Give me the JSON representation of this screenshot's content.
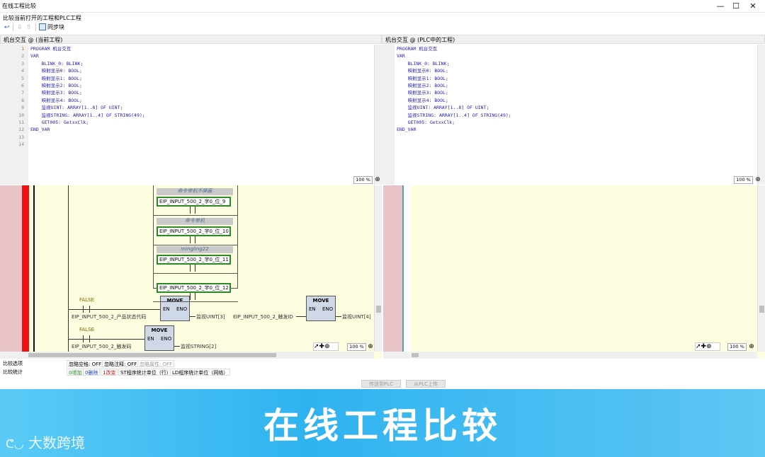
{
  "window": {
    "title": "在线工程比较",
    "min_glyph": "—",
    "max_glyph": "☐",
    "close_glyph": "✕"
  },
  "subtitle": "比较当前打开的工程和PLC工程",
  "toolbar": {
    "sync_label": "同步块"
  },
  "left_pane": {
    "header": "机台交互 @ (当前工程)",
    "zoom": "100 %"
  },
  "right_pane": {
    "header": "机台交互 @ (PLC中的工程)",
    "zoom": "100 %"
  },
  "line_numbers": [
    "1",
    "2",
    "3",
    "4",
    "5",
    "6",
    "7",
    "8",
    "9",
    "10",
    "11",
    "12",
    "13",
    "14"
  ],
  "code_lines": [
    "PROGRAM 机台交互",
    "VAR",
    "    BLINK_0: BLINK;",
    "    映射显示0: BOOL;",
    "    映射显示1: BOOL;",
    "    映射显示2: BOOL;",
    "    映射显示3: BOOL;",
    "    映射显示4: BOOL;",
    "    监视UINT: ARRAY[1..8] OF UINT;",
    "    监视STRING: ARRAY[1..4] OF STRING(49);",
    "    GET005: GetxxClk;",
    "END_VAR",
    "",
    ""
  ],
  "ladder": {
    "rungs": [
      {
        "comment": "命令单机不屏蔽",
        "var": "EIP_INPUT_500_2_字0_位_9"
      },
      {
        "comment": "命令单机",
        "var": "EIP_INPUT_500_2_字0_位_10"
      },
      {
        "comment": "mingling22",
        "var": "EIP_INPUT_500_2_字0_位_11"
      },
      {
        "comment": "",
        "var": "EIP_INPUT_500_2_字0_位_12"
      }
    ],
    "false1": "FALSE",
    "false2": "FALSE",
    "in1": "EIP_INPUT_500_2_产品状态代码",
    "in2": "EIP_INPUT_500_2_触发ID",
    "in3": "EIP_INPUT_500_2_触发码",
    "move_label": "MOVE",
    "en": "EN",
    "eno": "ENO",
    "out1": "监视UINT[3]",
    "out2": "监视UINT[4]",
    "out3": "监视STRING[2]"
  },
  "ladder_zoom_left": "100 %",
  "ladder_zoom_right": "100 %",
  "status": {
    "row1_label": "比较选项",
    "ignore_space": "忽略空格: OFF",
    "ignore_comment": "忽略注释: OFF",
    "ignore_attr": "忽略属性: OFF",
    "row2_label": "比较统计",
    "added": "0增加",
    "deleted": "0删除",
    "changed": "1改变",
    "st_unit": "ST程序统计单位（行）",
    "ld_unit": "LD程序统计单位（网络）"
  },
  "buttons": {
    "to_right": "传送到PLC",
    "to_left": "从PLC上传"
  },
  "banner": {
    "text": "在线工程比较",
    "watermark": "大数跨境"
  },
  "colors": {
    "accent": "#2fb3f0",
    "code": "#1e1eb4",
    "added": "#1a8a1a",
    "deleted": "#1a3cc8",
    "changed": "#d01010"
  }
}
